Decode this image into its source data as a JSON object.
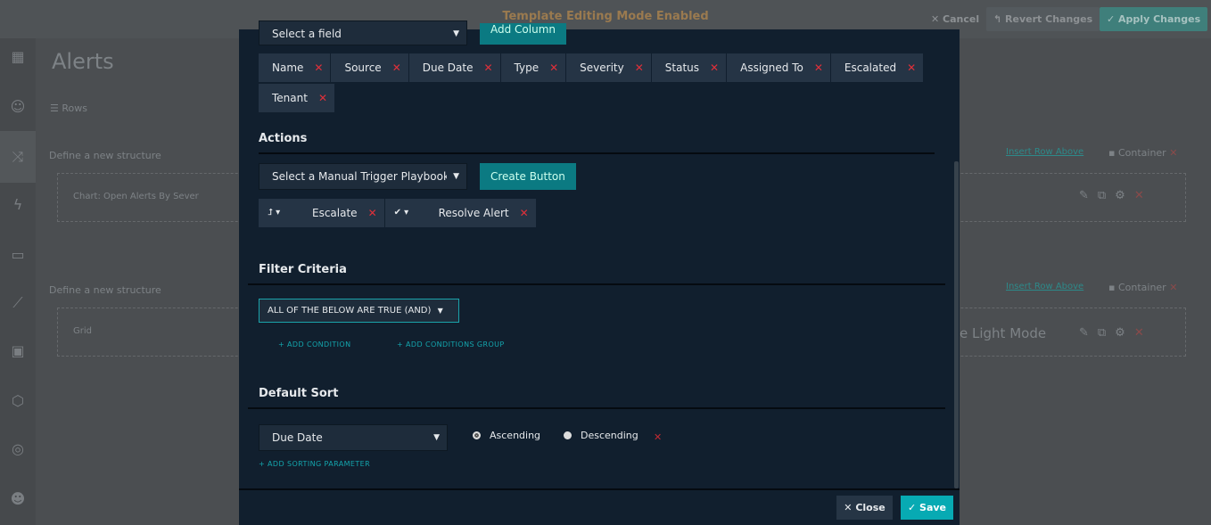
{
  "topbar": {
    "mode": "Template Editing Mode Enabled",
    "cancel": "Cancel",
    "revert": "Revert Changes",
    "apply": "Apply Changes"
  },
  "background": {
    "page_title": "Alerts",
    "rows": "Rows",
    "structure1": "Define a new structure",
    "structure2": "Define a new structure",
    "widget1": "Chart: Open Alerts By Sever",
    "widget2": "Grid",
    "insert_row": "Insert Row Above",
    "container": "Container",
    "light_mode": "e Light Mode"
  },
  "modal": {
    "field_select": "Select a field",
    "add_column": "Add Column",
    "columns": [
      "Name",
      "Source",
      "Due Date",
      "Type",
      "Severity",
      "Status",
      "Assigned To",
      "Escalated",
      "Tenant"
    ],
    "actions_title": "Actions",
    "playbook_select": "Select a Manual Trigger Playbook",
    "create_button": "Create Button",
    "actions": [
      {
        "icon": "arrow-up-icon",
        "label": "Escalate"
      },
      {
        "icon": "check-icon",
        "label": "Resolve Alert"
      }
    ],
    "filter_title": "Filter Criteria",
    "filter_mode": "ALL OF THE BELOW ARE TRUE (AND)",
    "add_condition": "ADD CONDITION",
    "add_group": "ADD CONDITIONS GROUP",
    "sort_title": "Default Sort",
    "sort_field": "Due Date",
    "ascending": "Ascending",
    "descending": "Descending",
    "sort_selected": "Ascending",
    "add_sort": "ADD SORTING PARAMETER",
    "close": "Close",
    "save": "Save"
  }
}
